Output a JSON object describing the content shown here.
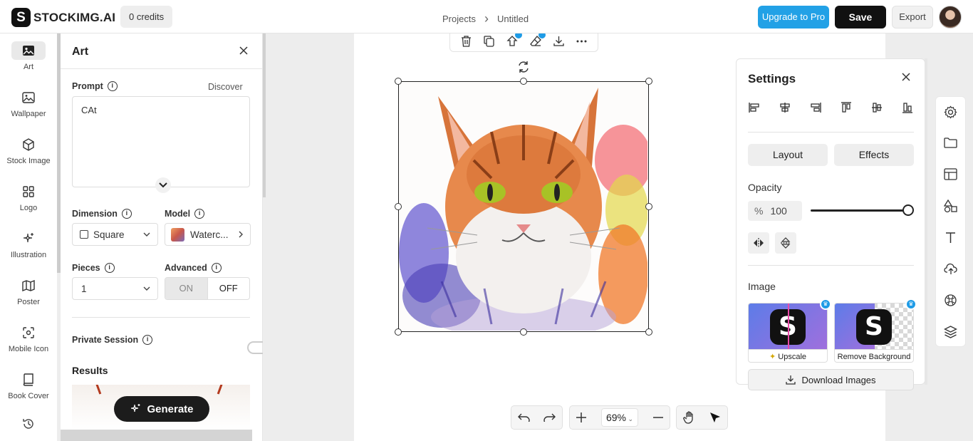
{
  "app": {
    "brand": "STOCKIMG.AI",
    "brand_mark": "S",
    "credits": "0 credits"
  },
  "breadcrumb": {
    "parent": "Projects",
    "sep": "›",
    "current": "Untitled"
  },
  "header": {
    "upgrade": "Upgrade to Pro",
    "save": "Save",
    "export": "Export"
  },
  "nav": [
    {
      "label": "Art",
      "icon": "image-icon"
    },
    {
      "label": "Wallpaper",
      "icon": "wallpaper-icon"
    },
    {
      "label": "Stock Image",
      "icon": "cube-icon"
    },
    {
      "label": "Logo",
      "icon": "grid-icon"
    },
    {
      "label": "Illustration",
      "icon": "sparkle-icon"
    },
    {
      "label": "Poster",
      "icon": "map-icon"
    },
    {
      "label": "Mobile Icon",
      "icon": "mobile-icon"
    },
    {
      "label": "Book Cover",
      "icon": "book-icon"
    }
  ],
  "panel": {
    "title": "Art",
    "prompt_label": "Prompt",
    "discover": "Discover",
    "prompt_value": "CAt",
    "dimension_label": "Dimension",
    "dimension_value": "Square",
    "model_label": "Model",
    "model_value": "Waterc...",
    "pieces_label": "Pieces",
    "pieces_value": "1",
    "advanced_label": "Advanced",
    "advanced_on": "ON",
    "advanced_off": "OFF",
    "private_label": "Private Session",
    "results_label": "Results",
    "generate": "Generate"
  },
  "settings": {
    "title": "Settings",
    "tab_layout": "Layout",
    "tab_effects": "Effects",
    "opacity_label": "Opacity",
    "opacity_unit": "%",
    "opacity_value": "100",
    "image_label": "Image",
    "upscale": "Upscale",
    "remove_bg": "Remove Background",
    "download": "Download Images"
  },
  "zoom": {
    "value": "69%"
  },
  "colors": {
    "accent": "#22a1e6",
    "dark": "#111111"
  }
}
